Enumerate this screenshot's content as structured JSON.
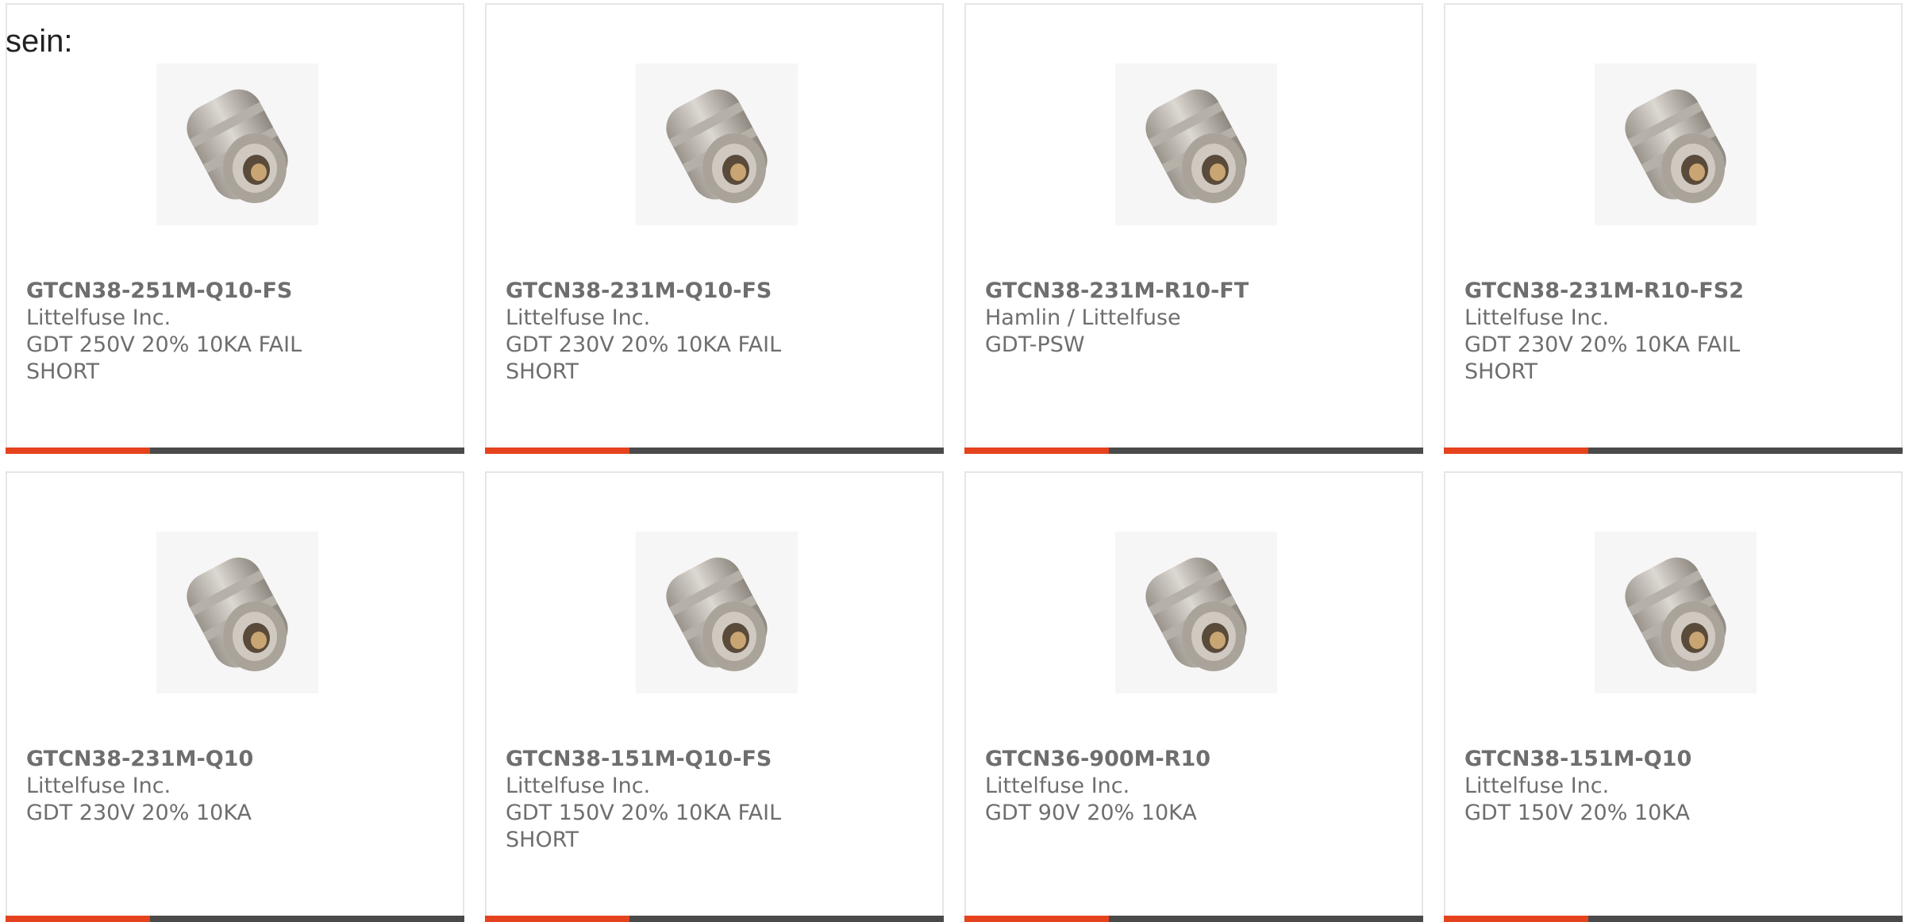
{
  "intro_text": "sein:",
  "colors": {
    "accent": "#e5421e",
    "bar": "#4a4a4a",
    "text": "#6e6e6e",
    "border": "#e6e6e6"
  },
  "product_icon": "gas-discharge-tube-icon",
  "products": [
    {
      "part_number": "GTCN38-251M-Q10-FS",
      "manufacturer": "Littelfuse Inc.",
      "description": "GDT 250V 20% 10KA FAIL SHORT"
    },
    {
      "part_number": "GTCN38-231M-Q10-FS",
      "manufacturer": "Littelfuse Inc.",
      "description": "GDT 230V 20% 10KA FAIL SHORT"
    },
    {
      "part_number": "GTCN38-231M-R10-FT",
      "manufacturer": "Hamlin / Littelfuse",
      "description": "GDT-PSW"
    },
    {
      "part_number": "GTCN38-231M-R10-FS2",
      "manufacturer": "Littelfuse Inc.",
      "description": "GDT 230V 20% 10KA FAIL SHORT"
    },
    {
      "part_number": "GTCN38-231M-Q10",
      "manufacturer": "Littelfuse Inc.",
      "description": "GDT 230V 20% 10KA"
    },
    {
      "part_number": "GTCN38-151M-Q10-FS",
      "manufacturer": "Littelfuse Inc.",
      "description": "GDT 150V 20% 10KA FAIL SHORT"
    },
    {
      "part_number": "GTCN36-900M-R10",
      "manufacturer": "Littelfuse Inc.",
      "description": "GDT 90V 20% 10KA"
    },
    {
      "part_number": "GTCN38-151M-Q10",
      "manufacturer": "Littelfuse Inc.",
      "description": "GDT 150V 20% 10KA"
    }
  ]
}
